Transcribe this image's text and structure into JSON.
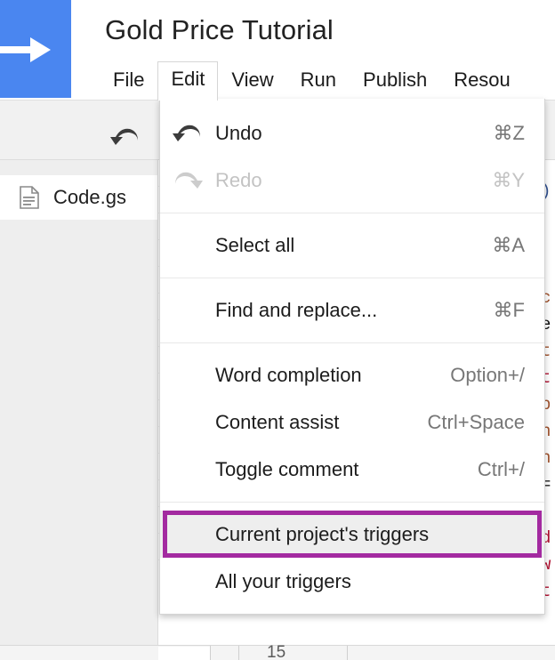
{
  "header": {
    "logo_icon": "apps-script-arrow-logo",
    "logo_color": "#4a86f0",
    "title": "Gold Price Tutorial"
  },
  "menubar": {
    "items": [
      {
        "label": "File",
        "active": false
      },
      {
        "label": "Edit",
        "active": true
      },
      {
        "label": "View",
        "active": false
      },
      {
        "label": "Run",
        "active": false
      },
      {
        "label": "Publish",
        "active": false
      },
      {
        "label": "Resou",
        "active": false
      }
    ]
  },
  "toolbar": {
    "undo_icon": "undo-arrow-icon"
  },
  "filelist": {
    "items": [
      {
        "label": "Code.gs",
        "icon": "script-file-icon"
      }
    ]
  },
  "edit_menu": {
    "groups": [
      {
        "items": [
          {
            "label": "Undo",
            "shortcut": "⌘Z",
            "icon": "undo-arrow-icon",
            "disabled": false,
            "highlighted": false
          },
          {
            "label": "Redo",
            "shortcut": "⌘Y",
            "icon": "redo-arrow-icon",
            "disabled": true,
            "highlighted": false
          }
        ]
      },
      {
        "items": [
          {
            "label": "Select all",
            "shortcut": "⌘A",
            "icon": "",
            "disabled": false,
            "highlighted": false
          }
        ]
      },
      {
        "items": [
          {
            "label": "Find and replace...",
            "shortcut": "⌘F",
            "icon": "",
            "disabled": false,
            "highlighted": false
          }
        ]
      },
      {
        "items": [
          {
            "label": "Word completion",
            "shortcut": "Option+/",
            "icon": "",
            "disabled": false,
            "highlighted": false
          },
          {
            "label": "Content assist",
            "shortcut": "Ctrl+Space",
            "icon": "",
            "disabled": false,
            "highlighted": false
          },
          {
            "label": "Toggle comment",
            "shortcut": "Ctrl+/",
            "icon": "",
            "disabled": false,
            "highlighted": false
          }
        ]
      },
      {
        "items": [
          {
            "label": "Current project's triggers",
            "shortcut": "",
            "icon": "",
            "disabled": false,
            "highlighted": true
          },
          {
            "label": "All your triggers",
            "shortcut": "",
            "icon": "",
            "disabled": false,
            "highlighted": false
          }
        ]
      }
    ],
    "highlight_color": "#a32aa0"
  },
  "editor": {
    "visible_code_fragments": [
      {
        "text": ")",
        "color": "#2f4f8f"
      },
      {
        "text": "c",
        "color": "#a0522d"
      },
      {
        "text": "e",
        "color": "#111111"
      },
      {
        "text": "t",
        "color": "#a0522d"
      },
      {
        "text": "t",
        "color": "#b01030"
      },
      {
        "text": "p",
        "color": "#a0522d"
      },
      {
        "text": "n",
        "color": "#a0522d"
      },
      {
        "text": "n",
        "color": "#a0522d"
      },
      {
        "text": "=",
        "color": "#222222"
      },
      {
        "text": "d",
        "color": "#b01030"
      },
      {
        "text": "w",
        "color": "#b01030"
      },
      {
        "text": "t",
        "color": "#b01030"
      }
    ]
  },
  "statusbar": {
    "line_number": "15"
  }
}
